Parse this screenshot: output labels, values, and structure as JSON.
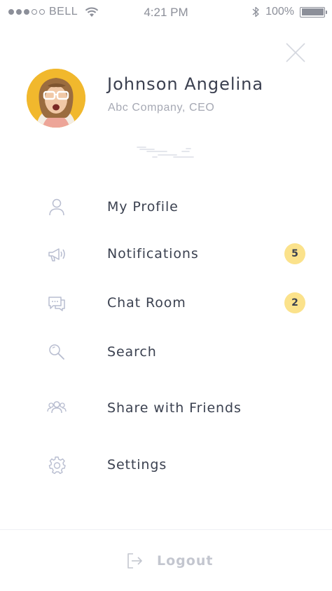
{
  "status_bar": {
    "carrier": "BELL",
    "time": "4:21 PM",
    "battery": "100%",
    "signal_dots_filled": 3,
    "signal_dots_total": 5
  },
  "profile": {
    "name": "Johnson Angelina",
    "role": "Abc Company, CEO",
    "avatar_bg_color": "#f1b82d"
  },
  "menu": {
    "items": [
      {
        "label": "My Profile",
        "icon": "user-icon"
      },
      {
        "label": "Notifications",
        "icon": "megaphone-icon",
        "badge": "5"
      },
      {
        "label": "Chat Room",
        "icon": "chat-icon",
        "badge": "2"
      },
      {
        "label": "Search",
        "icon": "search-icon"
      },
      {
        "label": "Share with Friends",
        "icon": "group-icon"
      },
      {
        "label": "Settings",
        "icon": "gear-icon"
      }
    ]
  },
  "footer": {
    "logout_label": "Logout",
    "logout_icon": "logout-icon"
  },
  "colors": {
    "text": "#3b4150",
    "muted": "#a6a9b4",
    "icon": "#b8bdd0",
    "badge": "#fbe28b"
  }
}
